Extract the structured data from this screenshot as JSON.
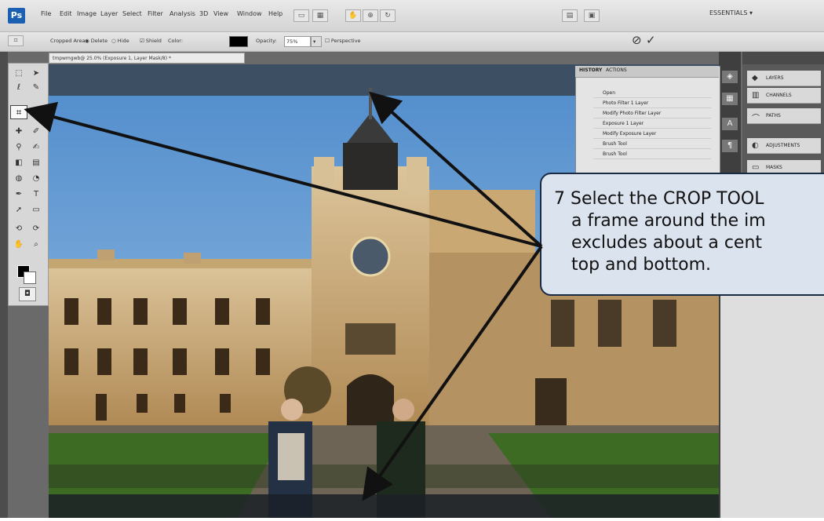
{
  "app": {
    "logo_text": "Ps",
    "menus": [
      "File",
      "Edit",
      "Image",
      "Layer",
      "Select",
      "Filter",
      "Analysis",
      "3D",
      "View",
      "Window",
      "Help"
    ],
    "workspace_label": "ESSENTIALS ▾"
  },
  "options_bar": {
    "cropped_area_label": "Cropped Area:",
    "delete_label": "Delete",
    "hide_label": "Hide",
    "shield_label": "Shield",
    "color_label": "Color:",
    "opacity_label": "Opacity:",
    "opacity_value": "75%",
    "perspective_label": "Perspective",
    "cancel_icon": "⊘",
    "commit_icon": "✓"
  },
  "document": {
    "tab_title": "tmpwmgwb@ 25.0% (Exposure 1, Layer Mask/8) *"
  },
  "history_panel": {
    "tabs": [
      "HISTORY",
      "ACTIONS"
    ],
    "items": [
      "Open",
      "Photo Filter 1 Layer",
      "Modify Photo Filter Layer",
      "Exposure 1 Layer",
      "Modify Exposure Layer",
      "Brush Tool",
      "Brush Tool"
    ]
  },
  "dock_panels": {
    "items": [
      "LAYERS",
      "CHANNELS",
      "PATHS",
      "ADJUSTMENTS",
      "MASKS"
    ]
  },
  "callout": {
    "line1": "7  Select the CROP TOOL",
    "line2": "a frame around the im",
    "line3": "excludes about a cent",
    "line4": "top and bottom."
  },
  "colors": {
    "callout_fill": "#dbe3ee",
    "callout_border": "#1a2a45",
    "arrow": "#111111",
    "sky": "#6ea3d9",
    "building": "#c9a874",
    "lawn": "#3d6b24"
  },
  "icons": [
    "crop-tool-icon",
    "cancel-crop-icon",
    "commit-crop-icon",
    "brush-icon",
    "layers-icon",
    "channels-icon",
    "paths-icon",
    "adjustments-icon",
    "masks-icon"
  ]
}
